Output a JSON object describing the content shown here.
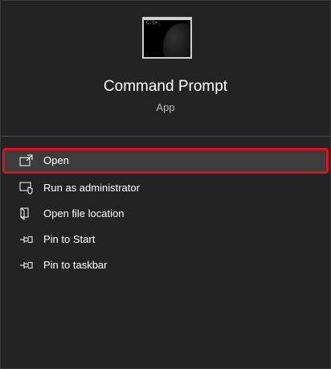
{
  "app": {
    "title": "Command Prompt",
    "subtitle": "App",
    "icon": "command-prompt-icon",
    "icon_prompt": "C:\\>_"
  },
  "menu": {
    "items": [
      {
        "label": "Open",
        "icon": "open-icon",
        "selected": true
      },
      {
        "label": "Run as administrator",
        "icon": "shield-icon",
        "selected": false
      },
      {
        "label": "Open file location",
        "icon": "file-location-icon",
        "selected": false
      },
      {
        "label": "Pin to Start",
        "icon": "pin-icon",
        "selected": false
      },
      {
        "label": "Pin to taskbar",
        "icon": "pin-icon",
        "selected": false
      }
    ]
  },
  "colors": {
    "background": "#232323",
    "highlight": "#3c3c3c",
    "selection_border": "#e0101d",
    "text": "#ffffff"
  }
}
